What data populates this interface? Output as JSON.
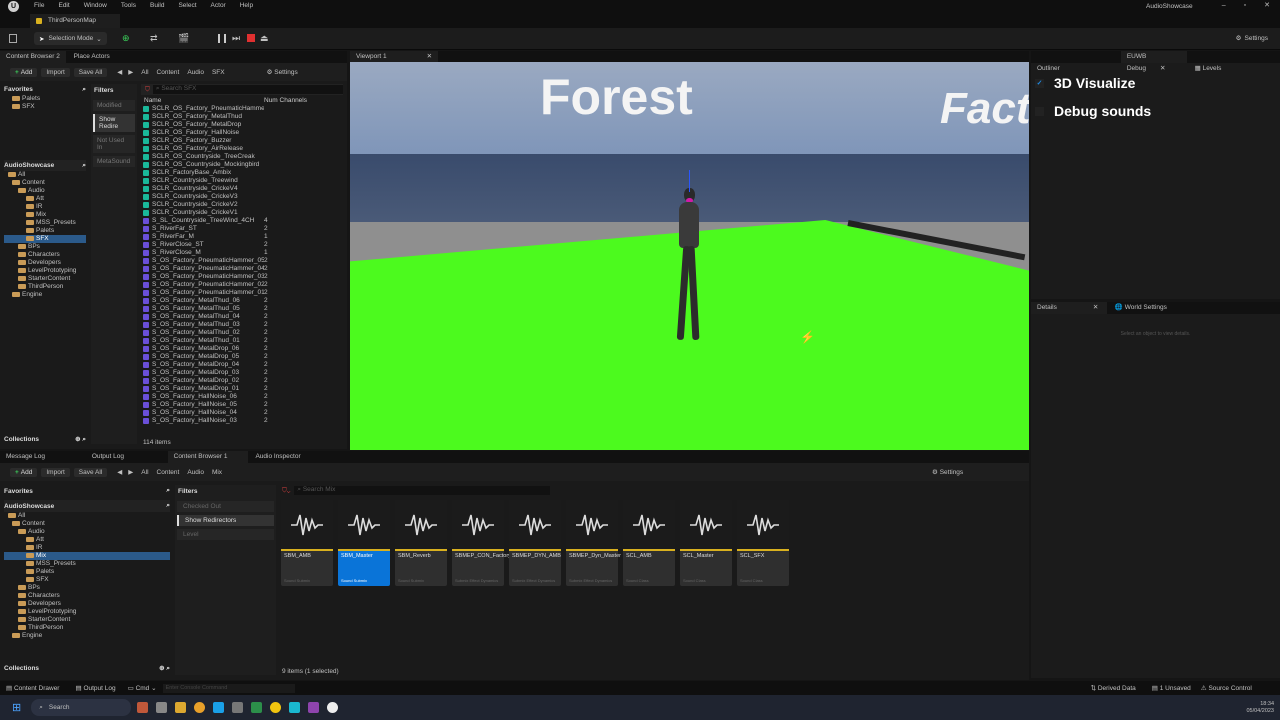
{
  "app": {
    "project_name": "AudioShowcase",
    "level_tab": "ThirdPersonMap"
  },
  "menu": [
    "File",
    "Edit",
    "Window",
    "Tools",
    "Build",
    "Select",
    "Actor",
    "Help"
  ],
  "toolbar": {
    "selection_mode": "Selection Mode",
    "settings": "Settings"
  },
  "top_left_tabs": [
    "Content Browser 2",
    "Place Actors"
  ],
  "cb_top": {
    "add": "Add",
    "import": "Import",
    "save_all": "Save All",
    "settings": "Settings",
    "path": [
      "All",
      "Content",
      "Audio",
      "SFX"
    ],
    "search_placeholder": "Search SFX",
    "favorites": "Favorites",
    "favorites_items": [
      "Palets",
      "SFX"
    ],
    "project": "AudioShowcase",
    "tree": [
      "All",
      "Content",
      "Audio",
      "Att",
      "IR",
      "Mix",
      "MSS_Presets",
      "Palets",
      "SFX",
      "BPs",
      "Characters",
      "Developers",
      "LevelPrototyping",
      "StarterContent",
      "ThirdPerson",
      "Engine"
    ],
    "filters": "Filters",
    "filter_items": [
      "Modified",
      "Show Redire",
      "Not Used In",
      "MetaSound"
    ],
    "col_name": "Name",
    "col_channels": "Num Channels",
    "assets": [
      {
        "name": "SCLR_OS_Factory_PneumaticHammer",
        "ch": ""
      },
      {
        "name": "SCLR_OS_Factory_MetalThud",
        "ch": ""
      },
      {
        "name": "SCLR_OS_Factory_MetalDrop",
        "ch": ""
      },
      {
        "name": "SCLR_OS_Factory_HallNoise",
        "ch": ""
      },
      {
        "name": "SCLR_OS_Factory_Buzzer",
        "ch": ""
      },
      {
        "name": "SCLR_OS_Factory_AirRelease",
        "ch": ""
      },
      {
        "name": "SCLR_OS_Countryside_TreeCreak",
        "ch": ""
      },
      {
        "name": "SCLR_OS_Countryside_Mockingbird",
        "ch": ""
      },
      {
        "name": "SCLR_FactoryBase_Ambix",
        "ch": ""
      },
      {
        "name": "SCLR_Countryside_Treewind",
        "ch": ""
      },
      {
        "name": "SCLR_Countryside_CrickeV4",
        "ch": ""
      },
      {
        "name": "SCLR_Countryside_CrickeV3",
        "ch": ""
      },
      {
        "name": "SCLR_Countryside_CrickeV2",
        "ch": ""
      },
      {
        "name": "SCLR_Countryside_CrickeV1",
        "ch": ""
      },
      {
        "name": "S_SL_Countryside_TreeWind_4CH",
        "ch": "4"
      },
      {
        "name": "S_RiverFar_ST",
        "ch": "2"
      },
      {
        "name": "S_RiverFar_M",
        "ch": "1"
      },
      {
        "name": "S_RiverClose_ST",
        "ch": "2"
      },
      {
        "name": "S_RiverClose_M",
        "ch": "1"
      },
      {
        "name": "S_OS_Factory_PneumaticHammer_05",
        "ch": "2"
      },
      {
        "name": "S_OS_Factory_PneumaticHammer_04",
        "ch": "2"
      },
      {
        "name": "S_OS_Factory_PneumaticHammer_03",
        "ch": "2"
      },
      {
        "name": "S_OS_Factory_PneumaticHammer_02",
        "ch": "2"
      },
      {
        "name": "S_OS_Factory_PneumaticHammer_01",
        "ch": "2"
      },
      {
        "name": "S_OS_Factory_MetalThud_06",
        "ch": "2"
      },
      {
        "name": "S_OS_Factory_MetalThud_05",
        "ch": "2"
      },
      {
        "name": "S_OS_Factory_MetalThud_04",
        "ch": "2"
      },
      {
        "name": "S_OS_Factory_MetalThud_03",
        "ch": "2"
      },
      {
        "name": "S_OS_Factory_MetalThud_02",
        "ch": "2"
      },
      {
        "name": "S_OS_Factory_MetalThud_01",
        "ch": "2"
      },
      {
        "name": "S_OS_Factory_MetalDrop_06",
        "ch": "2"
      },
      {
        "name": "S_OS_Factory_MetalDrop_05",
        "ch": "2"
      },
      {
        "name": "S_OS_Factory_MetalDrop_04",
        "ch": "2"
      },
      {
        "name": "S_OS_Factory_MetalDrop_03",
        "ch": "2"
      },
      {
        "name": "S_OS_Factory_MetalDrop_02",
        "ch": "2"
      },
      {
        "name": "S_OS_Factory_MetalDrop_01",
        "ch": "2"
      },
      {
        "name": "S_OS_Factory_HallNoise_06",
        "ch": "2"
      },
      {
        "name": "S_OS_Factory_HallNoise_05",
        "ch": "2"
      },
      {
        "name": "S_OS_Factory_HallNoise_04",
        "ch": "2"
      },
      {
        "name": "S_OS_Factory_HallNoise_03",
        "ch": "2"
      }
    ],
    "item_count": "114 items",
    "collections": "Collections"
  },
  "viewport": {
    "tab": "Viewport 1",
    "sign_1": "Forest",
    "sign_2": "Facto"
  },
  "right_tabs": [
    "Outliner",
    "EUWB Debug",
    "Levels"
  ],
  "debug": {
    "opt1": "3D Visualize",
    "opt2": "Debug sounds"
  },
  "details": {
    "tab1": "Details",
    "tab2": "World Settings",
    "empty": "Select an object to view details."
  },
  "bottom_tabs": [
    "Message Log",
    "Output Log",
    "Content Browser 1",
    "Audio Inspector"
  ],
  "cb_bottom": {
    "add": "Add",
    "import": "Import",
    "save_all": "Save All",
    "settings": "Settings",
    "path": [
      "All",
      "Content",
      "Audio",
      "Mix"
    ],
    "search_placeholder": "Search Mix",
    "favorites": "Favorites",
    "project": "AudioShowcase",
    "tree": [
      "All",
      "Content",
      "Audio",
      "Att",
      "IR",
      "Mix",
      "MSS_Presets",
      "Palets",
      "SFX",
      "BPs",
      "Characters",
      "Developers",
      "LevelPrototyping",
      "StarterContent",
      "ThirdPerson",
      "Engine"
    ],
    "filters": "Filters",
    "filter_items": [
      "Checked Out",
      "Show Redirectors",
      "Level"
    ],
    "tiles": [
      {
        "name": "SBM_AMB",
        "type": "Sound Submix"
      },
      {
        "name": "SBM_Master",
        "type": "Sound Submix"
      },
      {
        "name": "SBM_Reverb",
        "type": "Sound Submix"
      },
      {
        "name": "SBMEP_CON_Factory",
        "type": "Submix Effect Dynamics"
      },
      {
        "name": "SBMEP_DYN_AMB",
        "type": "Submix Effect Dynamics"
      },
      {
        "name": "SBMEP_Dyn_Master",
        "type": "Submix Effect Dynamics"
      },
      {
        "name": "SCL_AMB",
        "type": "Sound Class"
      },
      {
        "name": "SCL_Master",
        "type": "Sound Class"
      },
      {
        "name": "SCL_SFX",
        "type": "Sound Class"
      }
    ],
    "status": "9 items (1 selected)",
    "collections": "Collections"
  },
  "statusbar": {
    "content_drawer": "Content Drawer",
    "output_log": "Output Log",
    "cmd": "Cmd",
    "console_placeholder": "Enter Console Command",
    "derived": "Derived Data",
    "unsaved": "1 Unsaved",
    "source": "Source Control"
  },
  "taskbar": {
    "search": "Search",
    "time": "18:34",
    "date": "05/04/2023"
  }
}
